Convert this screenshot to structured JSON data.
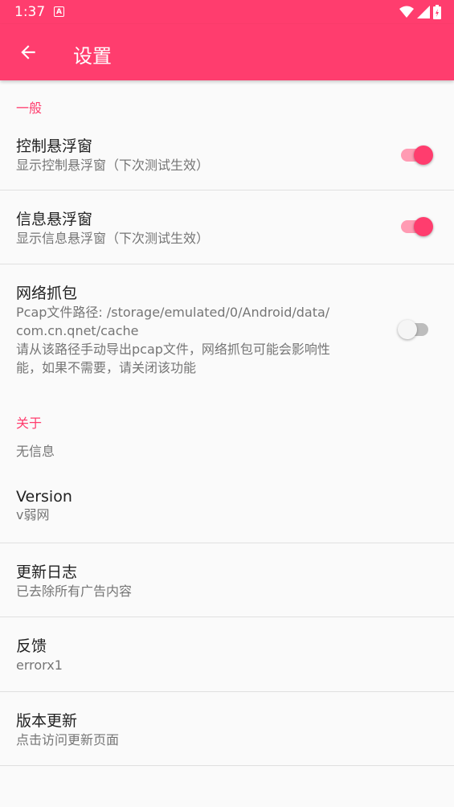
{
  "status_bar": {
    "time": "1:37",
    "badge": "A"
  },
  "app_bar": {
    "title": "设置"
  },
  "sections": {
    "general": "一般",
    "about": "关于"
  },
  "items": {
    "control_float": {
      "title": "控制悬浮窗",
      "subtitle": "显示控制悬浮窗（下次测试生效）",
      "enabled": true
    },
    "info_float": {
      "title": "信息悬浮窗",
      "subtitle": "显示信息悬浮窗（下次测试生效）",
      "enabled": true
    },
    "capture": {
      "title": "网络抓包",
      "subtitle_line1": "Pcap文件路径: /storage/emulated/0/Android/data/",
      "subtitle_line2": "com.cn.qnet/cache",
      "subtitle_line3": "请从该路径手动导出pcap文件，网络抓包可能会影响性",
      "subtitle_line4": "能，如果不需要，请关闭该功能",
      "enabled": false
    },
    "no_info": {
      "text": "无信息"
    },
    "version": {
      "title": "Version",
      "subtitle": "v弱网"
    },
    "changelog": {
      "title": "更新日志",
      "subtitle": "已去除所有广告内容"
    },
    "feedback": {
      "title": "反馈",
      "subtitle": "errorx1"
    },
    "update": {
      "title": "版本更新",
      "subtitle": "点击访问更新页面"
    }
  },
  "colors": {
    "accent": "#ff3d6e",
    "accent_light": "#ff9bb3"
  }
}
